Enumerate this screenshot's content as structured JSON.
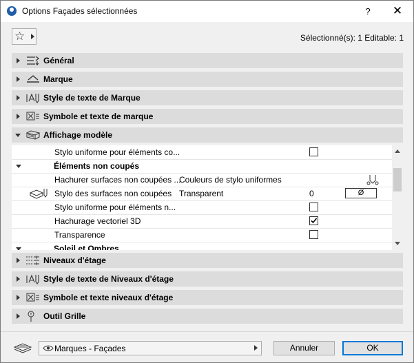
{
  "window": {
    "title": "Options Façades sélectionnées",
    "help_label": "?",
    "close_label": "✕"
  },
  "toolbar": {
    "favorites_icon": "star-icon",
    "selection_info": "Sélectionné(s): 1 Editable: 1"
  },
  "sections_top": [
    {
      "label": "Général",
      "icon": "general-settings-icon",
      "expanded": false
    },
    {
      "label": "Marque",
      "icon": "marker-icon",
      "expanded": false
    },
    {
      "label": "Style de texte de Marque",
      "icon": "text-style-icon",
      "expanded": false
    },
    {
      "label": "Symbole et texte de marque",
      "icon": "symbol-text-icon",
      "expanded": false
    },
    {
      "label": "Affichage modèle",
      "icon": "model-display-icon",
      "expanded": true
    }
  ],
  "panel": {
    "rows": [
      {
        "name": "Stylo uniforme pour éléments co...",
        "checked": false
      },
      {
        "group": "Éléments non coupés"
      },
      {
        "name": "Hachurer surfaces non coupées ...",
        "value": "Couleurs de stylo uniformes"
      },
      {
        "name": "Stylo des surfaces non coupées",
        "value": "Transparent",
        "number": "0",
        "pen_symbol": "Ø"
      },
      {
        "name": "Stylo uniforme pour éléments n...",
        "checked": false
      },
      {
        "name": "Hachurage vectoriel 3D",
        "checked": true
      },
      {
        "name": "Transparence",
        "checked": false
      },
      {
        "group": "Soleil et Ombres"
      }
    ]
  },
  "sections_bottom": [
    {
      "label": "Niveaux d'étage",
      "icon": "story-levels-icon",
      "expanded": false
    },
    {
      "label": "Style de texte de Niveaux d'étage",
      "icon": "text-style-icon",
      "expanded": false
    },
    {
      "label": "Symbole et texte niveaux d'étage",
      "icon": "symbol-text-icon",
      "expanded": false
    },
    {
      "label": "Outil Grille",
      "icon": "grid-tool-icon",
      "expanded": false
    }
  ],
  "footer": {
    "layer_value": "Marques - Façades",
    "cancel_label": "Annuler",
    "ok_label": "OK"
  },
  "colors": {
    "section_bg": "#dcdcdc",
    "ok_border": "#0078d7"
  }
}
